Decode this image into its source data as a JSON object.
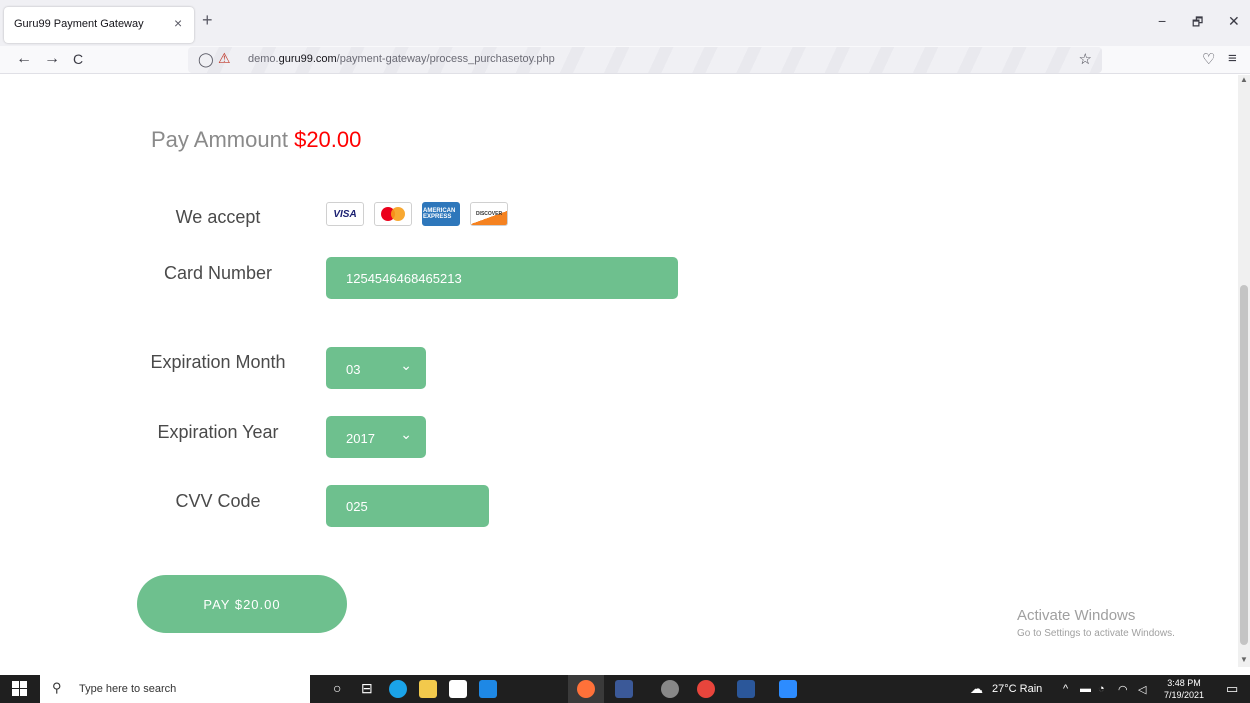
{
  "browser": {
    "tab_title": "Guru99 Payment Gateway",
    "tab_close": "×",
    "new_tab": "+",
    "url_host_prefix": "demo.",
    "url_host_main": "guru99.com",
    "url_path": "/payment-gateway/process_purchasetoy.php",
    "back": "←",
    "forward": "→",
    "reload": "C",
    "minimize": "−",
    "restore": "🗗",
    "close": "✕",
    "star": "☆",
    "pocket": "♡",
    "menu": "≡"
  },
  "page": {
    "pay_label": "Pay Ammount ",
    "pay_amount": "$20.00",
    "we_accept": "We accept",
    "cards": {
      "visa": "VISA",
      "amex": "AMERICAN EXPRESS",
      "discover": "DISCOVER"
    },
    "card_number_label": "Card Number",
    "card_number_value": "1254546468465213",
    "exp_month_label": "Expiration Month",
    "exp_month_value": "03",
    "exp_year_label": "Expiration Year",
    "exp_year_value": "2017",
    "cvv_label": "CVV Code",
    "cvv_value": "025",
    "pay_button": "PAY $20.00",
    "colors": {
      "accent": "#6ec08e",
      "amount": "#ff0000"
    }
  },
  "watermark": {
    "line1": "Activate Windows",
    "line2": "Go to Settings to activate Windows."
  },
  "taskbar": {
    "search_placeholder": "Type here to search",
    "weather": "27°C Rain",
    "time": "3:48 PM",
    "date": "7/19/2021"
  }
}
